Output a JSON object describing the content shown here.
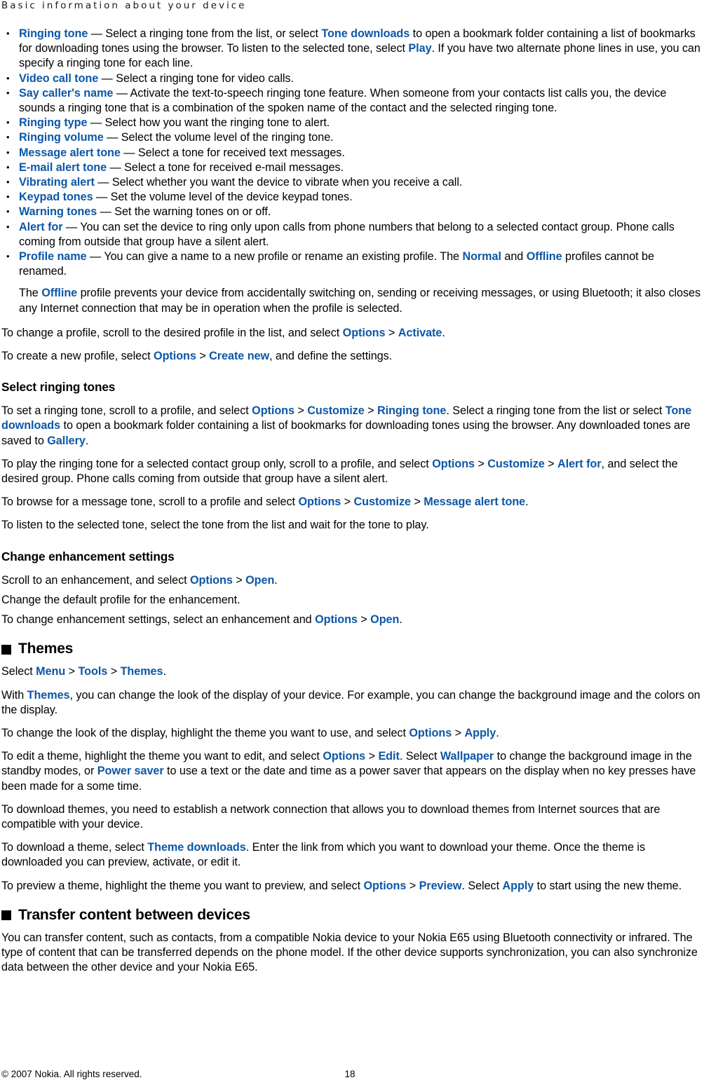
{
  "header": {
    "running_title": "Basic information about your device"
  },
  "colors": {
    "link_blue": "#0d57a6",
    "text_black": "#000000",
    "page_background": "#ffffff"
  },
  "bullets": [
    {
      "term": "Ringing tone",
      "dash": " — ",
      "parts": [
        {
          "t": "Select a ringing tone from the list, or select ",
          "k": "plain"
        },
        {
          "t": "Tone downloads",
          "k": "ui"
        },
        {
          "t": " to open a bookmark folder containing a list of bookmarks for downloading tones using the browser. To listen to the selected tone, select ",
          "k": "plain"
        },
        {
          "t": "Play",
          "k": "ui"
        },
        {
          "t": ". If you have two alternate phone lines in use, you can specify a ringing tone for each line.",
          "k": "plain"
        }
      ]
    },
    {
      "term": "Video call tone",
      "dash": " — ",
      "parts": [
        {
          "t": " Select a ringing tone for video calls.",
          "k": "plain"
        }
      ]
    },
    {
      "term": "Say caller's name",
      "dash": " — ",
      "parts": [
        {
          "t": "Activate the text-to-speech ringing tone feature. When someone from your contacts list calls you, the device sounds a ringing tone that is a combination of the spoken name of the contact and the selected ringing tone.",
          "k": "plain"
        }
      ]
    },
    {
      "term": "Ringing type",
      "dash": " — ",
      "parts": [
        {
          "t": "Select how you want the ringing tone to alert.",
          "k": "plain"
        }
      ]
    },
    {
      "term": "Ringing volume",
      "dash": " — ",
      "parts": [
        {
          "t": "Select the volume level of the ringing tone.",
          "k": "plain"
        }
      ]
    },
    {
      "term": "Message alert tone",
      "dash": " — ",
      "parts": [
        {
          "t": "Select a tone for received text messages.",
          "k": "plain"
        }
      ]
    },
    {
      "term": "E-mail alert tone",
      "dash": " — ",
      "parts": [
        {
          "t": "Select a tone for received e-mail messages.",
          "k": "plain"
        }
      ]
    },
    {
      "term": "Vibrating alert",
      "dash": " — ",
      "parts": [
        {
          "t": "Select whether you want the device to vibrate when you receive a call.",
          "k": "plain"
        }
      ]
    },
    {
      "term": "Keypad tones",
      "dash": " — ",
      "parts": [
        {
          "t": "Set the volume level of the device keypad tones.",
          "k": "plain"
        }
      ]
    },
    {
      "term": "Warning tones",
      "dash": " — ",
      "parts": [
        {
          "t": "Set the warning tones on or off.",
          "k": "plain"
        }
      ]
    },
    {
      "term": "Alert for",
      "dash": " — ",
      "parts": [
        {
          "t": "You can set the device to ring only upon calls from phone numbers that belong to a selected contact group. Phone calls coming from outside that group have a silent alert.",
          "k": "plain"
        }
      ]
    },
    {
      "term": "Profile name",
      "dash": " — ",
      "parts": [
        {
          "t": "You can give a name to a new profile or rename an existing profile. The ",
          "k": "plain"
        },
        {
          "t": "Normal",
          "k": "ui"
        },
        {
          "t": " and ",
          "k": "plain"
        },
        {
          "t": "Offline",
          "k": "ui"
        },
        {
          "t": " profiles cannot be renamed.",
          "k": "plain"
        }
      ]
    }
  ],
  "offline_note": {
    "parts": [
      {
        "t": "The ",
        "k": "plain"
      },
      {
        "t": "Offline",
        "k": "ui"
      },
      {
        "t": " profile prevents your device from accidentally switching on, sending or receiving messages, or using Bluetooth; it also closes any Internet connection that may be in operation when the profile is selected.",
        "k": "plain"
      }
    ]
  },
  "paragraphs": {
    "change_profile": {
      "parts": [
        {
          "t": "To change a profile, scroll to the desired profile in the list, and select ",
          "k": "plain"
        },
        {
          "t": "Options",
          "k": "ui"
        },
        {
          "t": " > ",
          "k": "sep"
        },
        {
          "t": "Activate",
          "k": "ui"
        },
        {
          "t": ".",
          "k": "plain"
        }
      ]
    },
    "create_profile": {
      "parts": [
        {
          "t": "To create a new profile, select ",
          "k": "plain"
        },
        {
          "t": "Options",
          "k": "ui"
        },
        {
          "t": " > ",
          "k": "sep"
        },
        {
          "t": "Create new",
          "k": "ui"
        },
        {
          "t": ", and define the settings.",
          "k": "plain"
        }
      ]
    },
    "set_ringing_tone": {
      "parts": [
        {
          "t": "To set a ringing tone, scroll to a profile, and select ",
          "k": "plain"
        },
        {
          "t": "Options",
          "k": "ui"
        },
        {
          "t": " > ",
          "k": "sep"
        },
        {
          "t": "Customize",
          "k": "ui"
        },
        {
          "t": " > ",
          "k": "sep"
        },
        {
          "t": "Ringing tone",
          "k": "ui"
        },
        {
          "t": ". Select a ringing tone from the list or select ",
          "k": "plain"
        },
        {
          "t": "Tone downloads",
          "k": "ui"
        },
        {
          "t": " to open a bookmark folder containing a list of bookmarks for downloading tones using the browser. Any downloaded tones are saved to ",
          "k": "plain"
        },
        {
          "t": "Gallery",
          "k": "ui"
        },
        {
          "t": ".",
          "k": "plain"
        }
      ]
    },
    "play_for_group": {
      "parts": [
        {
          "t": "To play the ringing tone for a selected contact group only, scroll to a profile, and select ",
          "k": "plain"
        },
        {
          "t": "Options",
          "k": "ui"
        },
        {
          "t": " > ",
          "k": "sep"
        },
        {
          "t": "Customize",
          "k": "ui"
        },
        {
          "t": " > ",
          "k": "sep"
        },
        {
          "t": "Alert for",
          "k": "ui"
        },
        {
          "t": ", and select the desired group. Phone calls coming from outside that group have a silent alert.",
          "k": "plain"
        }
      ]
    },
    "browse_message_tone": {
      "parts": [
        {
          "t": "To browse for a message tone, scroll to a profile and select ",
          "k": "plain"
        },
        {
          "t": "Options",
          "k": "ui"
        },
        {
          "t": " > ",
          "k": "sep"
        },
        {
          "t": "Customize",
          "k": "ui"
        },
        {
          "t": " > ",
          "k": "sep"
        },
        {
          "t": "Message alert tone",
          "k": "ui"
        },
        {
          "t": ".",
          "k": "plain"
        }
      ]
    },
    "listen_tone": {
      "parts": [
        {
          "t": "To listen to the selected tone, select the tone from the list and wait for the tone to play.",
          "k": "plain"
        }
      ]
    },
    "scroll_enhancement": {
      "parts": [
        {
          "t": "Scroll to an enhancement, and select ",
          "k": "plain"
        },
        {
          "t": "Options",
          "k": "ui"
        },
        {
          "t": " > ",
          "k": "sep"
        },
        {
          "t": "Open",
          "k": "ui"
        },
        {
          "t": ".",
          "k": "plain"
        }
      ]
    },
    "change_default_profile": {
      "parts": [
        {
          "t": "Change the default profile for the enhancement.",
          "k": "plain"
        }
      ]
    },
    "change_enhancement": {
      "parts": [
        {
          "t": "To change enhancement settings, select an enhancement and ",
          "k": "plain"
        },
        {
          "t": "Options",
          "k": "ui"
        },
        {
          "t": " > ",
          "k": "sep"
        },
        {
          "t": "Open",
          "k": "ui"
        },
        {
          "t": ".",
          "k": "plain"
        }
      ]
    },
    "themes_select": {
      "parts": [
        {
          "t": "Select ",
          "k": "plain"
        },
        {
          "t": "Menu",
          "k": "ui"
        },
        {
          "t": " > ",
          "k": "sep"
        },
        {
          "t": "Tools",
          "k": "ui"
        },
        {
          "t": " > ",
          "k": "sep"
        },
        {
          "t": "Themes",
          "k": "ui"
        },
        {
          "t": ".",
          "k": "plain"
        }
      ]
    },
    "themes_with": {
      "parts": [
        {
          "t": "With ",
          "k": "plain"
        },
        {
          "t": "Themes",
          "k": "ui"
        },
        {
          "t": ", you can change the look of the display of your device. For example, you can change the background image and the colors on the display.",
          "k": "plain"
        }
      ]
    },
    "themes_change_look": {
      "parts": [
        {
          "t": "To change the look of the display, highlight the theme you want to use, and select ",
          "k": "plain"
        },
        {
          "t": "Options",
          "k": "ui"
        },
        {
          "t": " > ",
          "k": "sep"
        },
        {
          "t": "Apply",
          "k": "ui"
        },
        {
          "t": ".",
          "k": "plain"
        }
      ]
    },
    "themes_edit": {
      "parts": [
        {
          "t": "To edit a theme, highlight the theme you want to edit, and select ",
          "k": "plain"
        },
        {
          "t": "Options",
          "k": "ui"
        },
        {
          "t": " > ",
          "k": "sep"
        },
        {
          "t": "Edit",
          "k": "ui"
        },
        {
          "t": ". Select ",
          "k": "plain"
        },
        {
          "t": "Wallpaper",
          "k": "ui"
        },
        {
          "t": " to change the background image in the standby modes, or ",
          "k": "plain"
        },
        {
          "t": "Power saver",
          "k": "ui"
        },
        {
          "t": " to use a text or the date and time as a power saver that appears on the display when no key presses have been made for a some time.",
          "k": "plain"
        }
      ]
    },
    "themes_download_network": {
      "parts": [
        {
          "t": "To download themes, you need to establish a network connection that allows you to download themes from Internet sources that are compatible with your device.",
          "k": "plain"
        }
      ]
    },
    "themes_download_theme": {
      "parts": [
        {
          "t": "To download a theme, select ",
          "k": "plain"
        },
        {
          "t": "Theme downloads",
          "k": "ui"
        },
        {
          "t": ". Enter the link from which you want to download your theme. Once the theme is downloaded you can preview, activate, or edit it.",
          "k": "plain"
        }
      ]
    },
    "themes_preview": {
      "parts": [
        {
          "t": "To preview a theme, highlight the theme you want to preview, and select ",
          "k": "plain"
        },
        {
          "t": "Options",
          "k": "ui"
        },
        {
          "t": " > ",
          "k": "sep"
        },
        {
          "t": "Preview",
          "k": "ui"
        },
        {
          "t": ". Select ",
          "k": "plain"
        },
        {
          "t": "Apply",
          "k": "ui"
        },
        {
          "t": " to start using the new theme.",
          "k": "plain"
        }
      ]
    },
    "transfer_intro": {
      "parts": [
        {
          "t": "You can transfer content, such as contacts, from a compatible Nokia device to your Nokia E65 using Bluetooth connectivity or infrared. The type of content that can be transferred depends on the phone model. If the other device supports synchronization, you can also synchronize data between the other device and your Nokia E65.",
          "k": "plain"
        }
      ]
    }
  },
  "headings": {
    "select_ringing_tones": "Select ringing tones",
    "change_enhancement_settings": "Change enhancement settings",
    "themes": "Themes",
    "transfer_content": "Transfer content between devices"
  },
  "footer": {
    "copyright": "© 2007 Nokia. All rights reserved.",
    "page_number": "18"
  }
}
